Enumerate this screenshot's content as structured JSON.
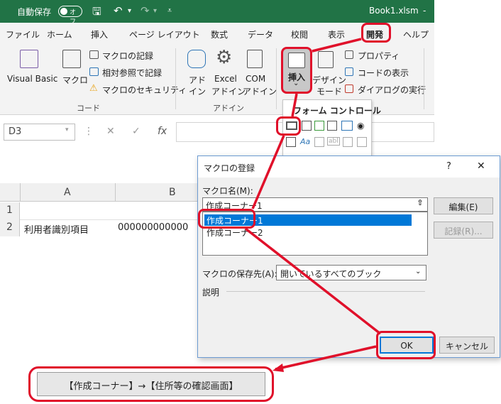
{
  "titlebar": {
    "autosave_label": "自動保存",
    "autosave_state": "オフ",
    "filename": "Book1.xlsm",
    "dash": "-"
  },
  "tabs": [
    "ファイル",
    "ホーム",
    "挿入",
    "ページ レイアウト",
    "数式",
    "データ",
    "校閲",
    "表示",
    "開発",
    "ヘルプ"
  ],
  "ribbon": {
    "code_group": {
      "visual_basic": "Visual Basic",
      "macro": "マクロ",
      "record_macro": "マクロの記録",
      "relative_ref": "相対参照で記録",
      "macro_security": "マクロのセキュリティ",
      "label": "コード"
    },
    "addin_group": {
      "addin_l1": "アド",
      "addin_l2": "イン",
      "excel_addin_l1": "Excel",
      "excel_addin_l2": "アドイン",
      "com_addin_l1": "COM",
      "com_addin_l2": "アドイン",
      "label": "アドイン"
    },
    "controls_group": {
      "insert": "挿入",
      "insert_chevron": "⌄",
      "design_l1": "デザイン",
      "design_l2": "モード",
      "properties": "プロパティ",
      "view_code": "コードの表示",
      "run_dialog": "ダイアログの実行"
    }
  },
  "formula_bar": {
    "name_box": "D3",
    "cancel": "✕",
    "enter": "✓",
    "fx": "fx"
  },
  "grid": {
    "columns": [
      "A",
      "B"
    ],
    "rows": [
      "1",
      "2"
    ],
    "a2": "利用者識別項目",
    "b2": "000000000000"
  },
  "form_controls": {
    "header": "フォーム コントロール",
    "label_glyph": "Aa",
    "textfield_glyph": "abl"
  },
  "dialog": {
    "title": "マクロの登録",
    "help": "?",
    "close": "✕",
    "macro_name_label": "マクロ名(M):",
    "macro_name_value": "作成コーナー1",
    "macros": [
      "作成コーナー1",
      "作成コーナー2"
    ],
    "edit_button": "編集(E)",
    "record_button": "記録(R)...",
    "store_label": "マクロの保存先(A):",
    "store_value": "開いているすべてのブック",
    "description_label": "説明",
    "ok_button": "OK",
    "cancel_button": "キャンセル"
  },
  "macro_button": {
    "label": "【作成コーナー】→【住所等の確認画面】"
  },
  "colors": {
    "excel_green": "#217346",
    "highlight_red": "#e0102a",
    "selection_blue": "#0078d7"
  }
}
